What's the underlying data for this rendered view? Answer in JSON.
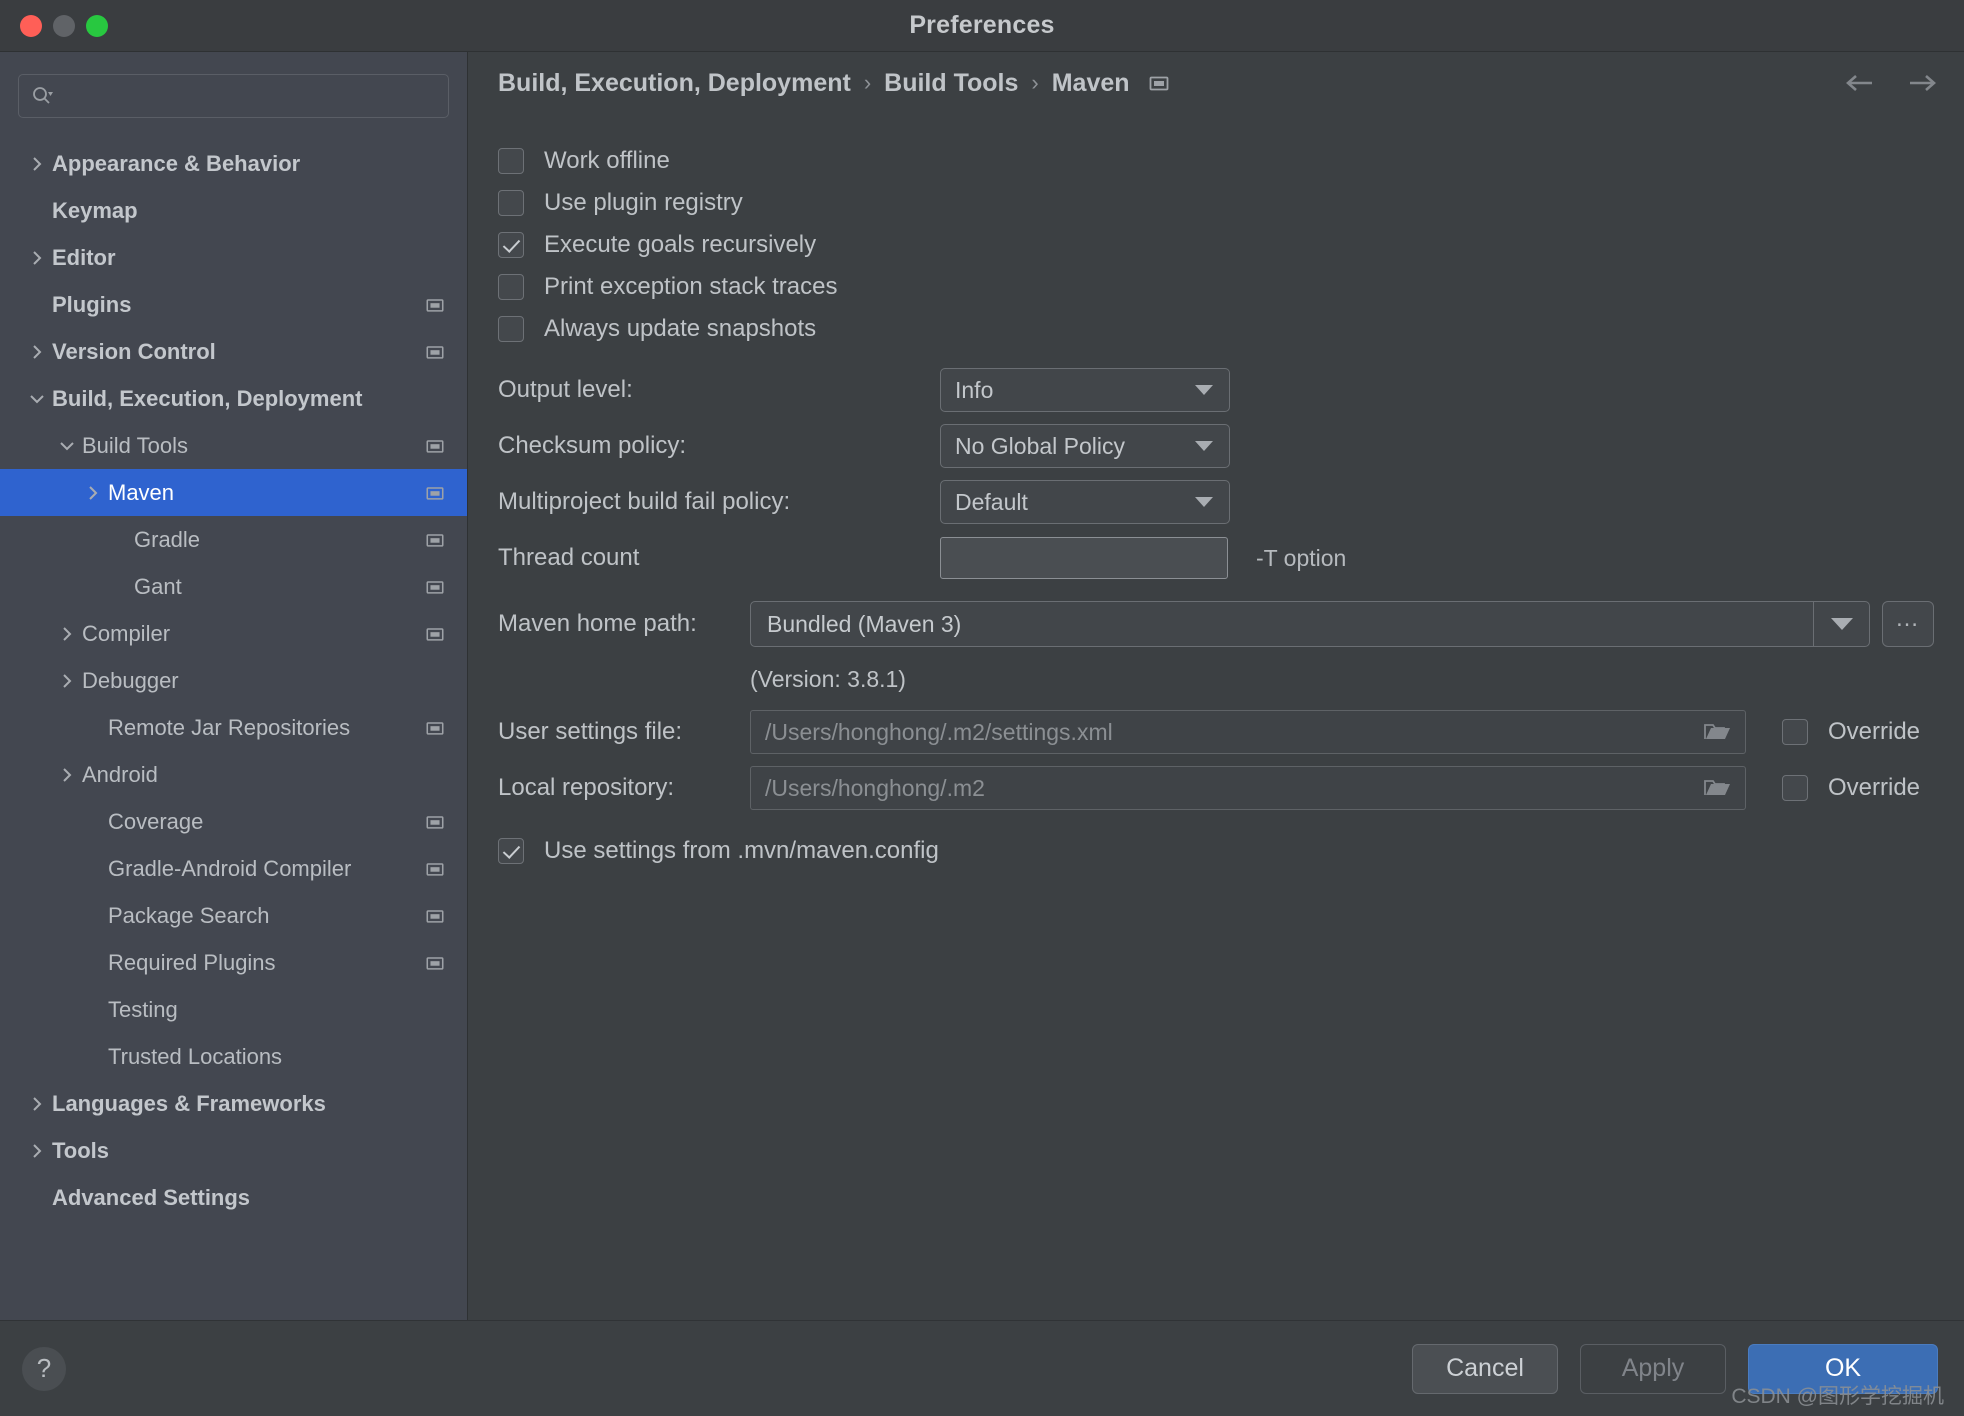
{
  "window": {
    "title": "Preferences",
    "traffic_lights": [
      "close-red",
      "minimize-amber",
      "zoom-green"
    ]
  },
  "sidebar": {
    "search": {
      "value": "",
      "placeholder": "",
      "icon": "search-icon"
    },
    "items": [
      {
        "label": "Appearance & Behavior",
        "level": 0,
        "twisty": "collapsed",
        "bold": true,
        "badge": false,
        "selected": false
      },
      {
        "label": "Keymap",
        "level": 0,
        "twisty": "none",
        "bold": true,
        "badge": false,
        "selected": false
      },
      {
        "label": "Editor",
        "level": 0,
        "twisty": "collapsed",
        "bold": true,
        "badge": false,
        "selected": false
      },
      {
        "label": "Plugins",
        "level": 0,
        "twisty": "none",
        "bold": true,
        "badge": true,
        "selected": false
      },
      {
        "label": "Version Control",
        "level": 0,
        "twisty": "collapsed",
        "bold": true,
        "badge": true,
        "selected": false
      },
      {
        "label": "Build, Execution, Deployment",
        "level": 0,
        "twisty": "expanded",
        "bold": true,
        "badge": false,
        "selected": false
      },
      {
        "label": "Build Tools",
        "level": 1,
        "twisty": "expanded",
        "bold": false,
        "badge": true,
        "selected": false
      },
      {
        "label": "Maven",
        "level": 2,
        "twisty": "collapsed",
        "bold": false,
        "badge": true,
        "selected": true
      },
      {
        "label": "Gradle",
        "level": 3,
        "twisty": "none",
        "bold": false,
        "badge": true,
        "selected": false
      },
      {
        "label": "Gant",
        "level": 3,
        "twisty": "none",
        "bold": false,
        "badge": true,
        "selected": false
      },
      {
        "label": "Compiler",
        "level": 1,
        "twisty": "collapsed",
        "bold": false,
        "badge": true,
        "selected": false
      },
      {
        "label": "Debugger",
        "level": 1,
        "twisty": "collapsed",
        "bold": false,
        "badge": false,
        "selected": false
      },
      {
        "label": "Remote Jar Repositories",
        "level": 2,
        "twisty": "none",
        "bold": false,
        "badge": true,
        "selected": false
      },
      {
        "label": "Android",
        "level": 1,
        "twisty": "collapsed",
        "bold": false,
        "badge": false,
        "selected": false
      },
      {
        "label": "Coverage",
        "level": 2,
        "twisty": "none",
        "bold": false,
        "badge": true,
        "selected": false
      },
      {
        "label": "Gradle-Android Compiler",
        "level": 2,
        "twisty": "none",
        "bold": false,
        "badge": true,
        "selected": false
      },
      {
        "label": "Package Search",
        "level": 2,
        "twisty": "none",
        "bold": false,
        "badge": true,
        "selected": false
      },
      {
        "label": "Required Plugins",
        "level": 2,
        "twisty": "none",
        "bold": false,
        "badge": true,
        "selected": false
      },
      {
        "label": "Testing",
        "level": 2,
        "twisty": "none",
        "bold": false,
        "badge": false,
        "selected": false
      },
      {
        "label": "Trusted Locations",
        "level": 2,
        "twisty": "none",
        "bold": false,
        "badge": false,
        "selected": false
      },
      {
        "label": "Languages & Frameworks",
        "level": 0,
        "twisty": "collapsed",
        "bold": true,
        "badge": false,
        "selected": false
      },
      {
        "label": "Tools",
        "level": 0,
        "twisty": "collapsed",
        "bold": true,
        "badge": false,
        "selected": false
      },
      {
        "label": "Advanced Settings",
        "level": 0,
        "twisty": "none",
        "bold": true,
        "badge": false,
        "selected": false
      }
    ]
  },
  "breadcrumb": {
    "parts": [
      "Build, Execution, Deployment",
      "Build Tools",
      "Maven"
    ],
    "separator": "›",
    "badge_icon": "project-settings-badge-icon",
    "back_icon": "arrow-left-icon",
    "forward_icon": "arrow-right-icon"
  },
  "main": {
    "checkboxes": [
      {
        "label": "Work offline",
        "checked": false
      },
      {
        "label": "Use plugin registry",
        "checked": false
      },
      {
        "label": "Execute goals recursively",
        "checked": true
      },
      {
        "label": "Print exception stack traces",
        "checked": false
      },
      {
        "label": "Always update snapshots",
        "checked": false
      }
    ],
    "combos": [
      {
        "label": "Output level:",
        "value": "Info"
      },
      {
        "label": "Checksum policy:",
        "value": "No Global Policy"
      },
      {
        "label": "Multiproject build fail policy:",
        "value": "Default"
      }
    ],
    "thread_count": {
      "label": "Thread count",
      "value": "",
      "hint": "-T option"
    },
    "maven_home": {
      "label": "Maven home path:",
      "value": "Bundled (Maven 3)",
      "browse_label": "…",
      "version_text": "(Version: 3.8.1)"
    },
    "paths": [
      {
        "label": "User settings file:",
        "value": "/Users/honghong/.m2/settings.xml",
        "folder_icon": "folder-icon",
        "override_label": "Override",
        "override_checked": false
      },
      {
        "label": "Local repository:",
        "value": "/Users/honghong/.m2",
        "folder_icon": "folder-icon",
        "override_label": "Override",
        "override_checked": false
      }
    ],
    "mvn_config": {
      "label": "Use settings from .mvn/maven.config",
      "checked": true
    }
  },
  "footer": {
    "help_label": "?",
    "cancel_label": "Cancel",
    "apply_label": "Apply",
    "ok_label": "OK"
  },
  "watermark": "CSDN @图形学挖掘机",
  "colors": {
    "selection_blue": "#2f63cf",
    "primary_button": "#3c6eb4",
    "sidebar_bg": "#434750",
    "panel_bg": "#3c4043"
  }
}
